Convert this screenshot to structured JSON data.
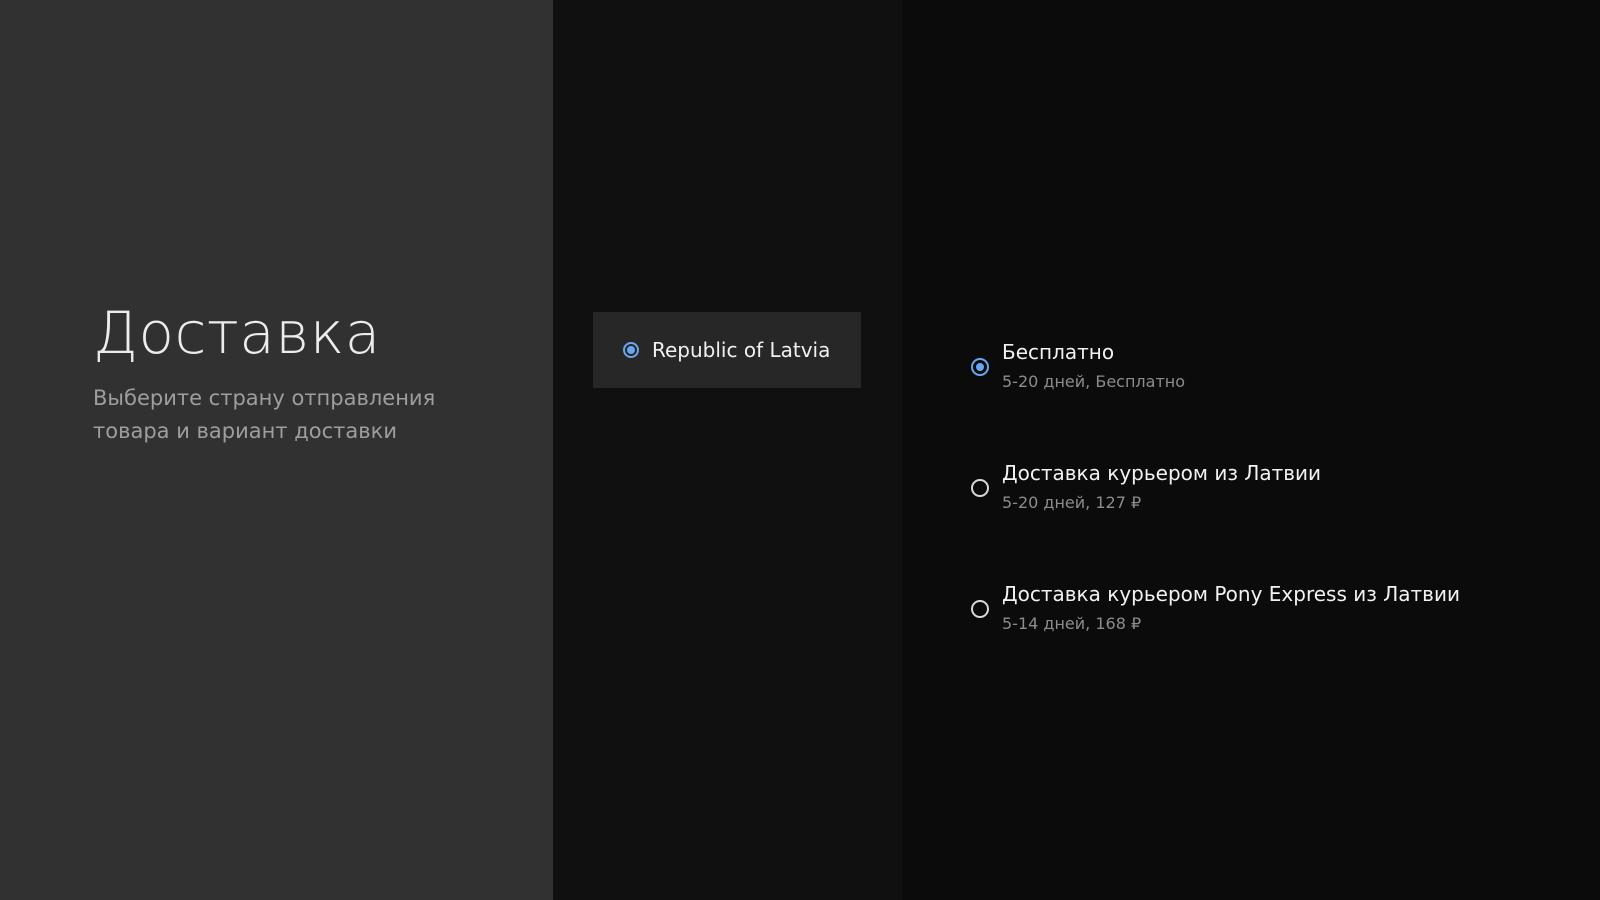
{
  "header": {
    "title": "Доставка",
    "subtitle": "Выберите страну отправления товара и вариант доставки"
  },
  "countries": [
    {
      "label": "Republic of Latvia",
      "selected": true,
      "icon": "radio-selected-icon"
    }
  ],
  "delivery_options": [
    {
      "title": "Бесплатно",
      "desc": "5-20 дней, Бесплатно",
      "selected": true
    },
    {
      "title": "Доставка курьером из Латвии",
      "desc": "5-20 дней, 127 ₽",
      "selected": false
    },
    {
      "title": "Доставка курьером Pony Express из Латвии",
      "desc": "5-14 дней, 168 ₽",
      "selected": false
    }
  ],
  "colors": {
    "left_panel": "#313131",
    "middle_panel": "#101010",
    "right_panel": "#0b0b0b",
    "accent": "#6aa5f0"
  }
}
